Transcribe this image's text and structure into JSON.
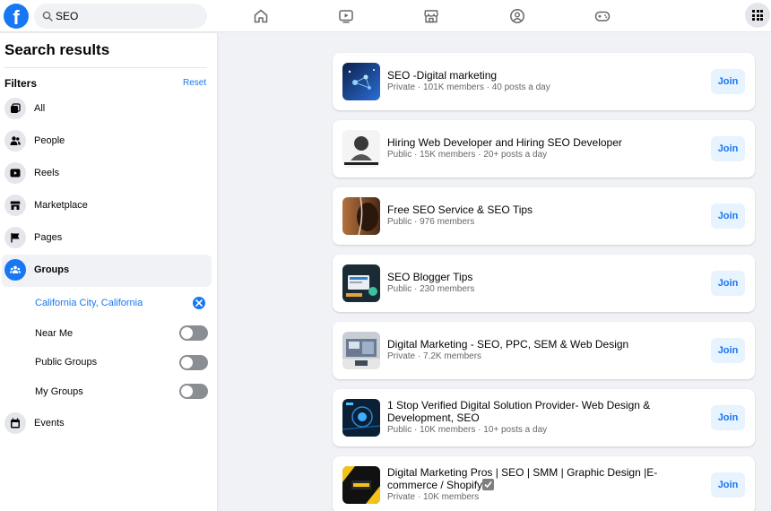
{
  "search": {
    "value": "SEO"
  },
  "nav_icons": [
    "home-icon",
    "watch-icon",
    "marketplace-icon",
    "groups-icon",
    "gaming-icon",
    "menu-icon"
  ],
  "sidebar": {
    "title": "Search results",
    "filters_label": "Filters",
    "reset_label": "Reset",
    "items": [
      {
        "label": "All",
        "icon": "all-icon"
      },
      {
        "label": "People",
        "icon": "people-icon"
      },
      {
        "label": "Reels",
        "icon": "reels-icon"
      },
      {
        "label": "Marketplace",
        "icon": "marketplace-icon"
      },
      {
        "label": "Pages",
        "icon": "flag-icon"
      },
      {
        "label": "Groups",
        "icon": "groups-icon",
        "active": true
      }
    ],
    "location": "California City, California",
    "toggles": [
      {
        "label": "Near Me",
        "on": false
      },
      {
        "label": "Public Groups",
        "on": false
      },
      {
        "label": "My Groups",
        "on": false
      }
    ],
    "events_label": "Events"
  },
  "results": [
    {
      "title": "SEO -Digital marketing",
      "meta": "Private · 101K members · 40 posts a day",
      "join": "Join"
    },
    {
      "title": "Hiring Web Developer and Hiring SEO Developer",
      "meta": "Public · 15K members · 20+ posts a day",
      "join": "Join"
    },
    {
      "title": "Free SEO Service & SEO Tips",
      "meta": "Public · 976 members",
      "join": "Join"
    },
    {
      "title": "SEO Blogger Tips",
      "meta": "Public · 230 members",
      "join": "Join"
    },
    {
      "title": "Digital Marketing - SEO, PPC, SEM & Web Design",
      "meta": "Private · 7.2K members",
      "join": "Join"
    },
    {
      "title": "1 Stop Verified Digital Solution Provider- Web Design & Development, SEO",
      "meta": "Public · 10K members · 10+ posts a day",
      "join": "Join"
    },
    {
      "title": "Digital Marketing Pros | SEO | SMM | Graphic Design |E-commerce / Shopify",
      "meta": "Private · 10K members",
      "join": "Join"
    }
  ],
  "colors": {
    "brand": "#1877f2",
    "join_bg": "#e7f3ff",
    "background": "#f0f2f5"
  }
}
